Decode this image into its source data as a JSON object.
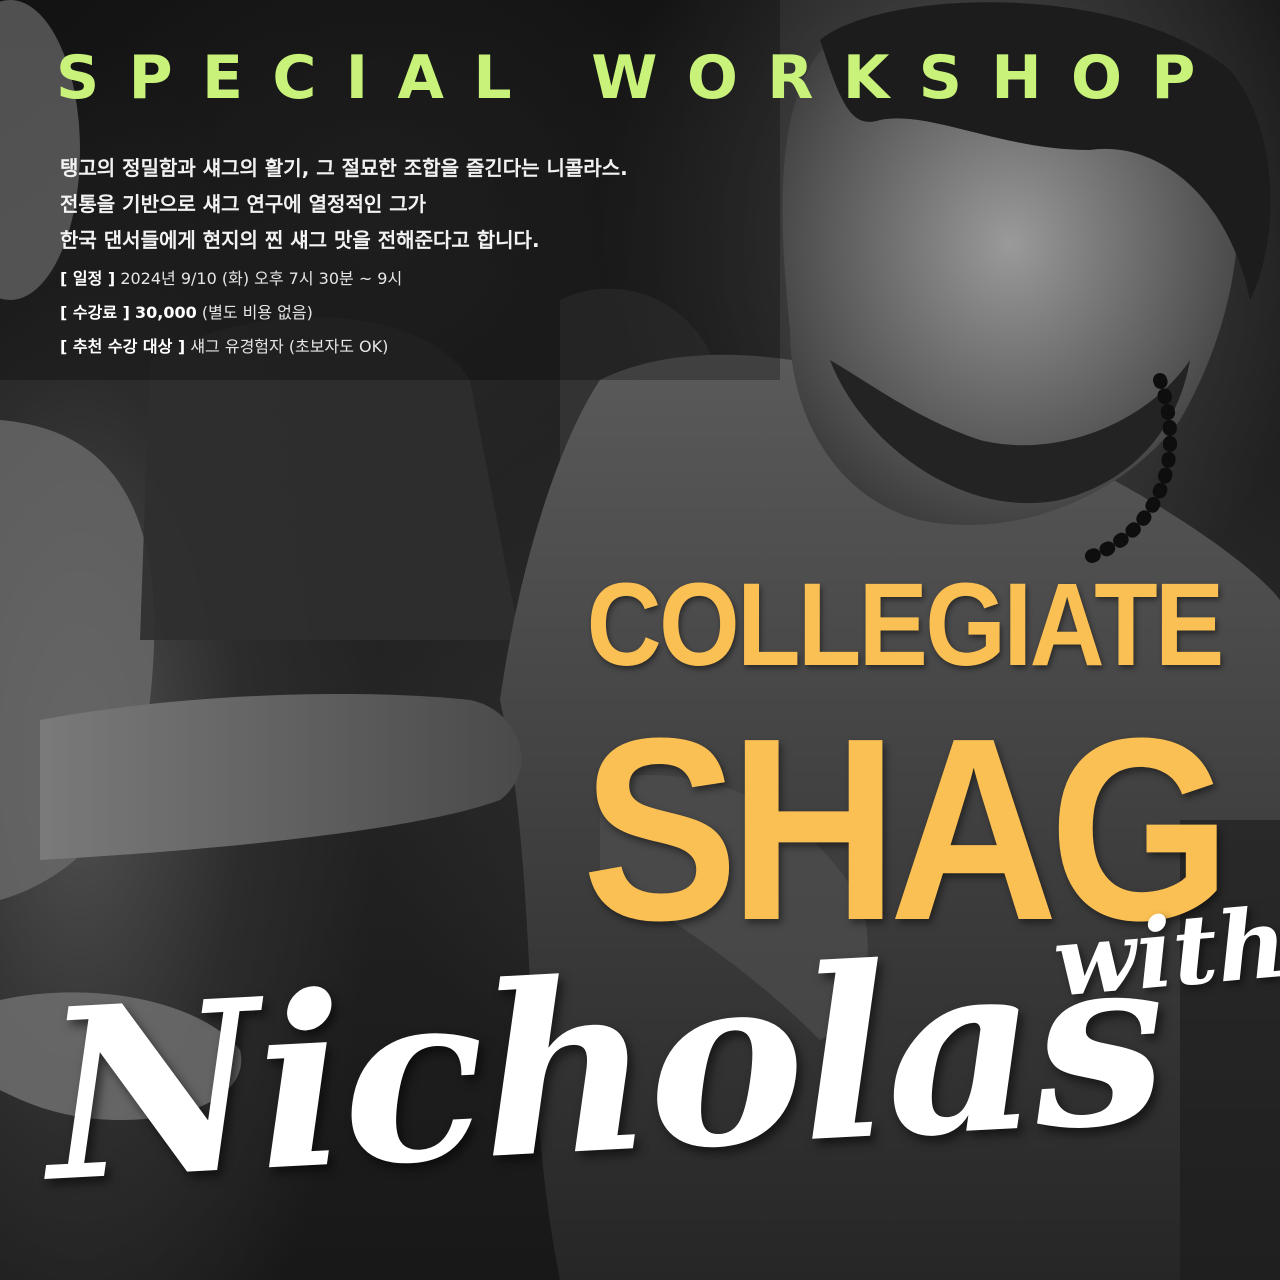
{
  "header": {
    "kicker": "SPECIAL WORKSHOP"
  },
  "intro": {
    "lines": [
      "탱고의 정밀함과 섀그의 활기, 그 절묘한 조합을 즐긴다는 니콜라스.",
      "전통을 기반으로 섀그 연구에 열정적인 그가",
      "한국 댄서들에게 현지의 찐 섀그 맛을 전해준다고 합니다."
    ]
  },
  "details": {
    "schedule": {
      "label": "[ 일정 ]",
      "value": "2024년 9/10 (화) 오후 7시 30분 ~ 9시"
    },
    "fee": {
      "label": "[ 수강료 ]",
      "amount": "30,000",
      "note": "(별도 비용 없음)"
    },
    "audience": {
      "label": "[ 추천 수강 대상 ]",
      "value": "섀그 유경험자 (초보자도 OK)"
    }
  },
  "title": {
    "line1": "COLLEGIATE",
    "line2": "SHAG",
    "with": "with",
    "name": "Nicholas"
  },
  "colors": {
    "kicker": "#c9f27a",
    "title": "#fbc053",
    "script": "#ffffff"
  }
}
